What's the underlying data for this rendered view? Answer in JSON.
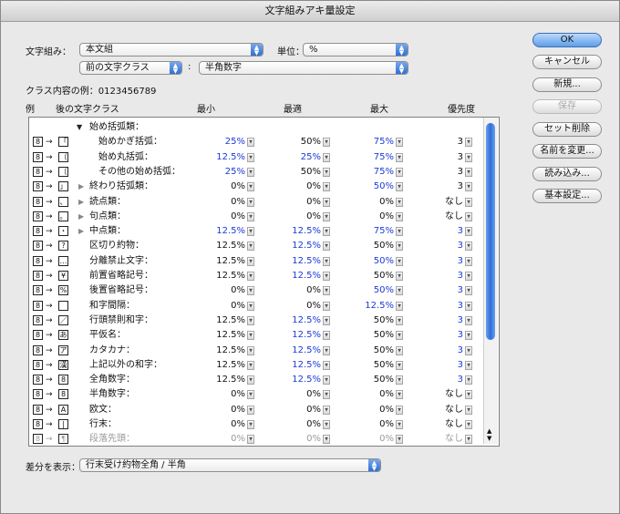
{
  "window_title": "文字組みアキ量設定",
  "top": {
    "mojikumi_label": "文字組み：",
    "mojikumi_value": "本文組",
    "unit_label": "単位：",
    "unit_value": "%",
    "prev_class_value": "前の文字クラス",
    "colon": ":",
    "next_class_value": "半角数字",
    "example_label": "クラス内容の例：0123456789"
  },
  "headers": {
    "ex": "例",
    "next_class": "後の文字クラス",
    "min": "最小",
    "opt": "最適",
    "max": "最大",
    "priority": "優先度"
  },
  "buttons": {
    "ok": "OK",
    "cancel": "キャンセル",
    "new": "新規...",
    "save": "保存",
    "set_delete": "セット削除",
    "rename": "名前を変更...",
    "load": "読み込み...",
    "basic": "基本設定..."
  },
  "bottom": {
    "diff_label": "差分を表示：",
    "diff_value": "行末受け約物全角 / 半角"
  },
  "rows": [
    {
      "icon": "",
      "tri": "open",
      "indent": 0,
      "label": "始め括弧類：",
      "min": "",
      "min_blue": false,
      "opt": "",
      "opt_blue": false,
      "max": "",
      "max_blue": false,
      "pri": "",
      "pri_blue": false,
      "group": true
    },
    {
      "icon": "「",
      "tri": "",
      "indent": 2,
      "label": "始めかぎ括弧：",
      "min": "25%",
      "min_blue": true,
      "opt": "50%",
      "opt_blue": false,
      "max": "75%",
      "max_blue": true,
      "pri": "3",
      "pri_blue": false
    },
    {
      "icon": "（",
      "tri": "",
      "indent": 2,
      "label": "始め丸括弧：",
      "min": "12.5%",
      "min_blue": true,
      "opt": "25%",
      "opt_blue": true,
      "max": "75%",
      "max_blue": true,
      "pri": "3",
      "pri_blue": false
    },
    {
      "icon": "〔",
      "tri": "",
      "indent": 2,
      "label": "その他の始め括弧：",
      "min": "25%",
      "min_blue": true,
      "opt": "50%",
      "opt_blue": false,
      "max": "75%",
      "max_blue": true,
      "pri": "3",
      "pri_blue": false
    },
    {
      "icon": "」",
      "tri": "closed",
      "indent": 1,
      "label": "終わり括弧類：",
      "min": "0%",
      "min_blue": false,
      "opt": "0%",
      "opt_blue": false,
      "max": "50%",
      "max_blue": true,
      "pri": "3",
      "pri_blue": false
    },
    {
      "icon": "、",
      "tri": "closed",
      "indent": 1,
      "label": "読点類：",
      "min": "0%",
      "min_blue": false,
      "opt": "0%",
      "opt_blue": false,
      "max": "0%",
      "max_blue": false,
      "pri": "なし",
      "pri_blue": false
    },
    {
      "icon": "。",
      "tri": "closed",
      "indent": 1,
      "label": "句点類：",
      "min": "0%",
      "min_blue": false,
      "opt": "0%",
      "opt_blue": false,
      "max": "0%",
      "max_blue": false,
      "pri": "なし",
      "pri_blue": false
    },
    {
      "icon": "・",
      "tri": "closed",
      "indent": 1,
      "label": "中点類：",
      "min": "12.5%",
      "min_blue": true,
      "opt": "12.5%",
      "opt_blue": true,
      "max": "75%",
      "max_blue": true,
      "pri": "3",
      "pri_blue": true
    },
    {
      "icon": "?",
      "tri": "",
      "indent": 1,
      "label": "区切り約物：",
      "min": "12.5%",
      "min_blue": false,
      "opt": "12.5%",
      "opt_blue": true,
      "max": "50%",
      "max_blue": false,
      "pri": "3",
      "pri_blue": true
    },
    {
      "icon": "…",
      "tri": "",
      "indent": 1,
      "label": "分離禁止文字：",
      "min": "12.5%",
      "min_blue": false,
      "opt": "12.5%",
      "opt_blue": true,
      "max": "50%",
      "max_blue": true,
      "pri": "3",
      "pri_blue": true
    },
    {
      "icon": "¥",
      "tri": "",
      "indent": 1,
      "label": "前置省略記号：",
      "min": "12.5%",
      "min_blue": false,
      "opt": "12.5%",
      "opt_blue": true,
      "max": "50%",
      "max_blue": false,
      "pri": "3",
      "pri_blue": true
    },
    {
      "icon": "%",
      "tri": "",
      "indent": 1,
      "label": "後置省略記号：",
      "min": "0%",
      "min_blue": false,
      "opt": "0%",
      "opt_blue": false,
      "max": "50%",
      "max_blue": true,
      "pri": "3",
      "pri_blue": true
    },
    {
      "icon": "",
      "tri": "",
      "indent": 1,
      "label": "和字間隔：",
      "min": "0%",
      "min_blue": false,
      "opt": "0%",
      "opt_blue": false,
      "max": "12.5%",
      "max_blue": true,
      "pri": "3",
      "pri_blue": true
    },
    {
      "icon": "／",
      "tri": "",
      "indent": 1,
      "label": "行頭禁則和字：",
      "min": "12.5%",
      "min_blue": false,
      "opt": "12.5%",
      "opt_blue": true,
      "max": "50%",
      "max_blue": false,
      "pri": "3",
      "pri_blue": true
    },
    {
      "icon": "あ",
      "tri": "",
      "indent": 1,
      "label": "平仮名：",
      "min": "12.5%",
      "min_blue": false,
      "opt": "12.5%",
      "opt_blue": true,
      "max": "50%",
      "max_blue": false,
      "pri": "3",
      "pri_blue": true
    },
    {
      "icon": "ア",
      "tri": "",
      "indent": 1,
      "label": "カタカナ：",
      "min": "12.5%",
      "min_blue": false,
      "opt": "12.5%",
      "opt_blue": true,
      "max": "50%",
      "max_blue": false,
      "pri": "3",
      "pri_blue": true
    },
    {
      "icon": "漢",
      "tri": "",
      "indent": 1,
      "label": "上記以外の和字：",
      "min": "12.5%",
      "min_blue": false,
      "opt": "12.5%",
      "opt_blue": true,
      "max": "50%",
      "max_blue": false,
      "pri": "3",
      "pri_blue": true
    },
    {
      "icon": "8",
      "tri": "",
      "indent": 1,
      "label": "全角数字：",
      "min": "12.5%",
      "min_blue": false,
      "opt": "12.5%",
      "opt_blue": true,
      "max": "50%",
      "max_blue": false,
      "pri": "3",
      "pri_blue": true
    },
    {
      "icon": "8",
      "tri": "",
      "indent": 1,
      "label": "半角数字：",
      "min": "0%",
      "min_blue": false,
      "opt": "0%",
      "opt_blue": false,
      "max": "0%",
      "max_blue": false,
      "pri": "なし",
      "pri_blue": false
    },
    {
      "icon": "A",
      "tri": "",
      "indent": 1,
      "label": "欧文：",
      "min": "0%",
      "min_blue": false,
      "opt": "0%",
      "opt_blue": false,
      "max": "0%",
      "max_blue": false,
      "pri": "なし",
      "pri_blue": false
    },
    {
      "icon": "|",
      "tri": "",
      "indent": 1,
      "label": "行末：",
      "min": "0%",
      "min_blue": false,
      "opt": "0%",
      "opt_blue": false,
      "max": "0%",
      "max_blue": false,
      "pri": "なし",
      "pri_blue": false
    },
    {
      "icon": "¶",
      "tri": "",
      "indent": 1,
      "label": "段落先頭：",
      "min": "0%",
      "min_blue": false,
      "opt": "0%",
      "opt_blue": false,
      "max": "0%",
      "max_blue": false,
      "pri": "なし",
      "pri_blue": false,
      "grey": true
    }
  ],
  "prefix_icon": "8",
  "arrow_glyph": "→",
  "colors": {
    "blue_value": "#1a3ad8",
    "ok_button": "#5e9eea",
    "scroll_thumb": "#2f6fd6"
  }
}
